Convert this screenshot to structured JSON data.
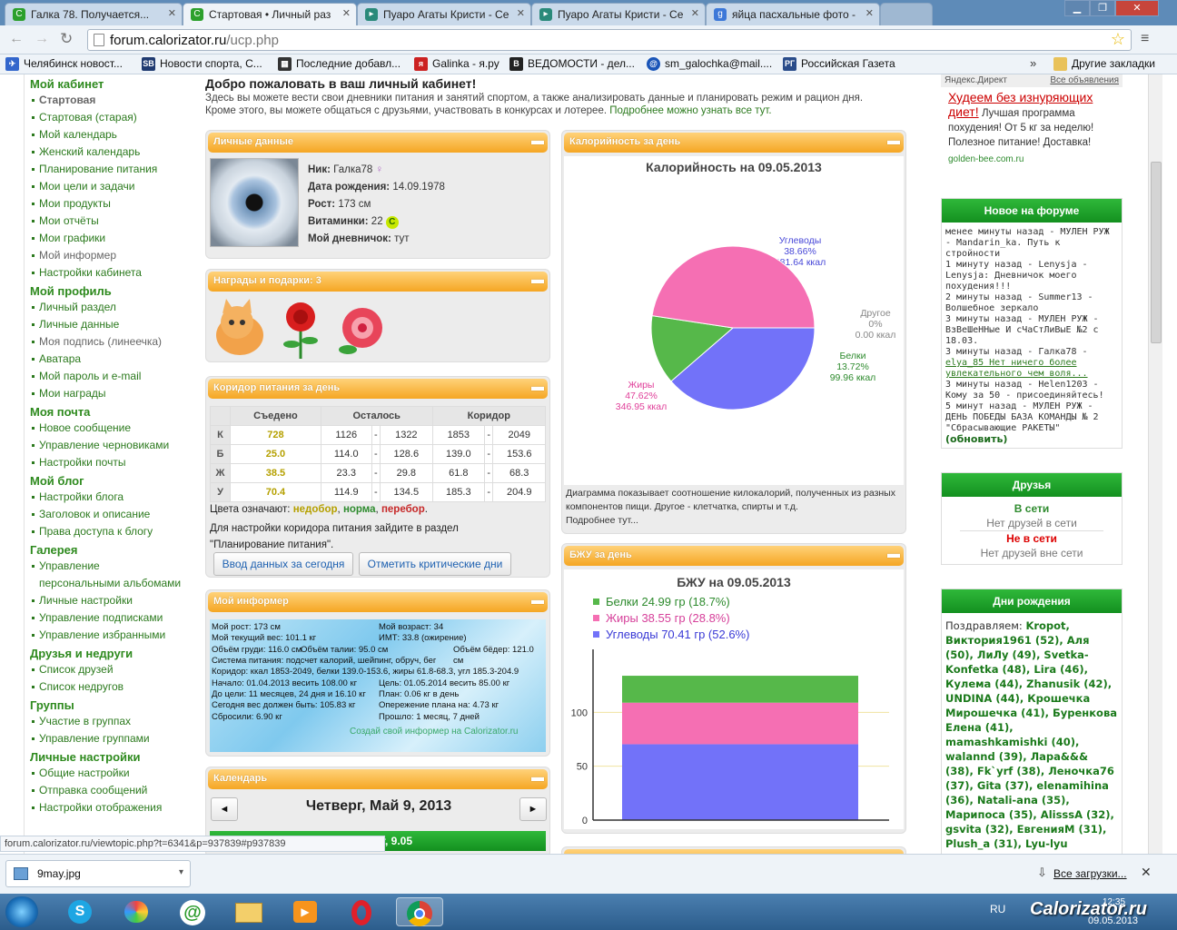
{
  "browser": {
    "tabs": [
      {
        "label": "Галка 78. Получается..."
      },
      {
        "label": "Стартовая • Личный раз"
      },
      {
        "label": "Пуаро Агаты Кристи - Се"
      },
      {
        "label": "Пуаро Агаты Кристи - Се"
      },
      {
        "label": "яйца пасхальные фото -"
      }
    ],
    "url_host": "forum.calorizator.ru",
    "url_path": "/ucp.php",
    "bookmarks": [
      {
        "label": "Челябинск новост..."
      },
      {
        "label": "Новости спорта, С..."
      },
      {
        "label": "Последние добавл..."
      },
      {
        "label": "Galinka - я.ру"
      },
      {
        "label": "ВЕДОМОСТИ - дел..."
      },
      {
        "label": "sm_galochka@mail...."
      },
      {
        "label": "Российская Газета"
      }
    ],
    "more_bookmarks": "»",
    "other_bookmarks": "Другие закладки",
    "status_url": "forum.calorizator.ru/viewtopic.php?t=6341&p=937839#p937839",
    "download_file": "9may.jpg",
    "all_downloads": "Все загрузки..."
  },
  "nav": {
    "sections": [
      {
        "title": "Мой кабинет",
        "items": [
          "Стартовая",
          "Стартовая (старая)",
          "Мой календарь",
          "Женский календарь",
          "Планирование питания",
          "Мои цели и задачи",
          "Мои продукты",
          "Мои отчёты",
          "Мои графики",
          "Мой информер",
          "Настройки кабинета"
        ]
      },
      {
        "title": "Мой профиль",
        "items": [
          "Личный раздел",
          "Личные данные",
          "Моя подпись (линеечка)",
          "Аватара",
          "Мой пароль и e-mail",
          "Мои награды"
        ]
      },
      {
        "title": "Моя почта",
        "items": [
          "Новое сообщение",
          "Управление черновиками",
          "Настройки почты"
        ]
      },
      {
        "title": "Мой блог",
        "items": [
          "Настройки блога",
          "Заголовок и описание",
          "Права доступа к блогу"
        ]
      },
      {
        "title": "Галерея",
        "items": [
          "Управление",
          "персональными альбомами",
          "Личные настройки",
          "Управление подписками",
          "Управление избранными"
        ]
      },
      {
        "title": "Друзья и недруги",
        "items": [
          "Список друзей",
          "Список недругов"
        ]
      },
      {
        "title": "Группы",
        "items": [
          "Участие в группах",
          "Управление группами"
        ]
      },
      {
        "title": "Личные настройки",
        "items": [
          "Общие настройки",
          "Отправка сообщений",
          "Настройки отображения"
        ]
      }
    ]
  },
  "welcome": {
    "title": "Добро пожаловать в ваш личный кабинет!",
    "line1": "Здесь вы можете вести свои дневники питания и занятий спортом, а также анализировать данные и планировать режим и рацион дня.",
    "line2": "Кроме этого, вы можете общаться с друзьями, участвовать в конкурсах и лотерее.",
    "more_link": "Подробнее можно узнать все тут."
  },
  "personal": {
    "header": "Личные данные",
    "nick_label": "Ник:",
    "nick": "Галка78",
    "birth_label": "Дата рождения:",
    "birth": "14.09.1978",
    "height_label": "Рост:",
    "height": "173 см",
    "vit_label": "Витаминки:",
    "vit": "22",
    "vit_badge": "C",
    "diary_label": "Мой дневничок:",
    "diary": "тут"
  },
  "awards": {
    "header": "Награды и подарки: 3"
  },
  "corridor": {
    "header": "Коридор питания за день",
    "cols": [
      "Съедено",
      "Осталось",
      "Коридор"
    ],
    "rows": [
      {
        "k": "К",
        "eaten": "728",
        "left_from": "1126",
        "left_to": "1322",
        "cor_from": "1853",
        "cor_to": "2049"
      },
      {
        "k": "Б",
        "eaten": "25.0",
        "left_from": "114.0",
        "left_to": "128.6",
        "cor_from": "139.0",
        "cor_to": "153.6"
      },
      {
        "k": "Ж",
        "eaten": "38.5",
        "left_from": "23.3",
        "left_to": "29.8",
        "cor_from": "61.8",
        "cor_to": "68.3"
      },
      {
        "k": "У",
        "eaten": "70.4",
        "left_from": "114.9",
        "left_to": "134.5",
        "cor_from": "185.3",
        "cor_to": "204.9"
      }
    ],
    "dash": "-",
    "legend_prefix": "Цвета означают:",
    "legend_under": "недобор",
    "legend_sep": ",",
    "legend_norm": "норма",
    "legend_over": "перебор",
    "legend_end": ".",
    "note1": "Для настройки коридора питания зайдите в раздел",
    "note2": "\"Планирование питания\".",
    "btn_enter": "Ввод данных за сегодня",
    "btn_crit": "Отметить критические дни"
  },
  "informer": {
    "header": "Мой информер",
    "l1a": "Мой рост: 173 см",
    "l1b": "Мой возраст: 34",
    "l2a": "Мой текущий вес: 101.1 кг",
    "l2b": "ИМТ: 33.8 (ожирение)",
    "l3a": "Объём груди: 116.0 см",
    "l3b": "Объём талии: 95.0 см",
    "l3c": "Объём бёдер: 121.0 см",
    "l4": "Система питания: подсчет калорий, шейпинг, обруч, бег",
    "l5": "Коридор: ккал 1853-2049, белки 139.0-153.6, жиры 61.8-68.3, угл 185.3-204.9",
    "l6a": "Начало: 01.04.2013 весить 108.00 кг",
    "l6b": "Цель: 01.05.2014 весить 85.00 кг",
    "l7a": "До цели: 11 месяцев, 24 дня и 16.10 кг",
    "l7b": "План: 0.06 кг в день",
    "l8a": "Сегодня вес должен быть: 105.83 кг",
    "l8b": "Опережение плана на: 4.73 кг",
    "l9a": "Сбросили: 6.90 кг",
    "l9b": "Прошло: 1 месяц, 7 дней",
    "footer": "Создай свой информер на Calorizator.ru"
  },
  "calendar": {
    "header": "Календарь",
    "title": "Четверг, Май 9, 2013",
    "prev": "◄",
    "next": "►",
    "sub": "Четверг, 9.05"
  },
  "calories": {
    "header": "Калорийность за день",
    "footer": "Диаграмма показывает соотношение килокалорий, полученных из разных компонентов пищи. Другое - клетчатка, спирты и т.д.",
    "more": "Подробнее тут..."
  },
  "bju": {
    "header": "БЖУ за день"
  },
  "chart_data": [
    {
      "type": "pie",
      "title": "Калорийность на 09.05.2013",
      "slices": [
        {
          "label": "Углеводы",
          "percent": "38.66%",
          "value": "281.64 ккал",
          "v": 281.64,
          "color": "#7272f9"
        },
        {
          "label": "Другое",
          "percent": "0%",
          "value": "0.00 ккал",
          "v": 0,
          "color": "#aaaaaa"
        },
        {
          "label": "Белки",
          "percent": "13.72%",
          "value": "99.96 ккал",
          "v": 99.96,
          "color": "#56b84a"
        },
        {
          "label": "Жиры",
          "percent": "47.62%",
          "value": "346.95 ккал",
          "v": 346.95,
          "color": "#f56fb3"
        }
      ]
    },
    {
      "type": "bar",
      "title": "БЖУ на 09.05.2013",
      "series": [
        {
          "name": "Белки 24.99 гр (18.7%)",
          "value": 24.99,
          "color": "#56b84a",
          "text": "#2e8b2e"
        },
        {
          "name": "Жиры 38.55 гр (28.8%)",
          "value": 38.55,
          "color": "#f56fb3",
          "text": "#d6409a"
        },
        {
          "name": "Углеводы 70.41 гр (52.6%)",
          "value": 70.41,
          "color": "#7272f9",
          "text": "#3a3ad6"
        }
      ],
      "yticks": [
        "0",
        "50",
        "100"
      ],
      "ylim": [
        0,
        150
      ]
    }
  ],
  "ad": {
    "label": "Яндекс.Директ",
    "all": "Все объявления",
    "title": "Худеем без изнуряющих диет!",
    "text": "Лучшая программа похудения! От 5 кг за неделю! Полезное питание! Доставка!",
    "domain": "golden-bee.com.ru"
  },
  "forum_news": {
    "header": "Новое на форуме",
    "items": [
      "менее минуты назад - МУЛЕН РУЖ - Mandarin_ka. Путь к стройности",
      "1 минуту назад - Lenysja - Lenysja: Дневничок моего похудения!!!",
      "2 минуты назад - Summer13 - Волшебное зеркало",
      "3 минуты назад - МУЛЕН РУЖ - ВзВеШеННые И сЧаСтЛиВыЕ №2 с 18.03.",
      "3 минуты назад - Галка78 -"
    ],
    "link_item": "elya_85 Нет ничего более увлекательного чем воля...",
    "items2": [
      "3 минуты назад - Helen1203 - Кому за 50 - присоединяйтесь!",
      "5 минут назад - МУЛЕН РУЖ - ДЕНЬ ПОБЕДЫ БАЗА КОМАНДЫ № 2 \"Сбрасывающие РАКЕТЫ\""
    ],
    "refresh": "(обновить)"
  },
  "friends": {
    "header": "Друзья",
    "online": "В сети",
    "online_none": "Нет друзей в сети",
    "offline": "Не в сети",
    "offline_none": "Нет друзей вне сети"
  },
  "birthdays": {
    "header": "Дни рождения",
    "text": "Поздравляем: Kropot, Виктория1961 (52), Аля (50), ЛиЛу (49), Svetka-Konfetka (48), Lira (46), Кулема (44), Zhanusik (42), UNDINA (44), Крошечка Мирошечка (41), Буренкова Елена (41), mamashkamishki (40), walannd (39), Лара&&& (38), Fk`yrf (38), Леночка76 (37), Gita (37), elenamihina (36), Natali-ana (35), Марипоса (35), AlisssA (32), gsvita (32), ЕвгенияМ (31), Plush_a (31), Lyu-lyu"
  },
  "taskbar": {
    "lang": "RU",
    "time": "12:35",
    "date": "09.05.2013",
    "watermark": "Calorizator.ru"
  }
}
